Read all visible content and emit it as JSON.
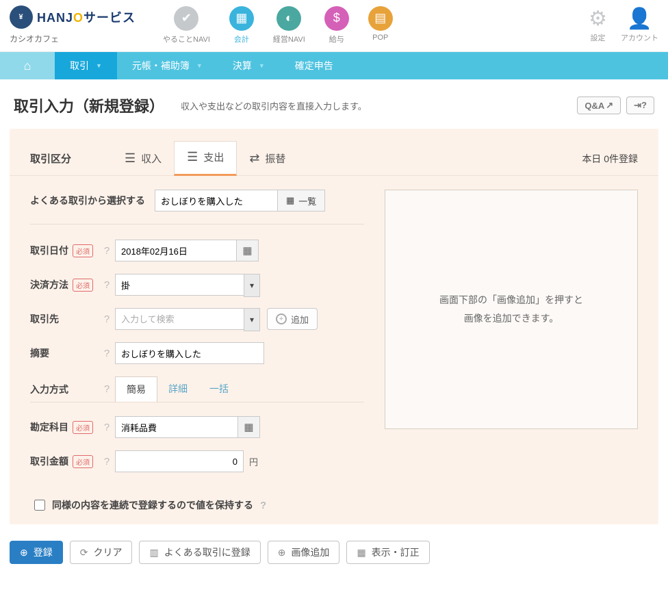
{
  "header": {
    "logo_text_pre": "HANJ",
    "logo_text_o": "O",
    "logo_text_post": "サービス",
    "company": "カシオカフェ",
    "nav": [
      {
        "label": "やることNAVI"
      },
      {
        "label": "会計"
      },
      {
        "label": "経営NAVI"
      },
      {
        "label": "給与"
      },
      {
        "label": "POP"
      }
    ],
    "right": {
      "settings": "設定",
      "account": "アカウント"
    }
  },
  "subnav": {
    "items": [
      {
        "label": "取引"
      },
      {
        "label": "元帳・補助簿"
      },
      {
        "label": "決算"
      },
      {
        "label": "確定申告"
      }
    ]
  },
  "page": {
    "heading": "取引入力（新規登録）",
    "desc": "収入や支出などの取引内容を直接入力します。",
    "qa_label": "Q&A"
  },
  "tabs": {
    "section_label": "取引区分",
    "items": [
      {
        "label": "収入"
      },
      {
        "label": "支出"
      },
      {
        "label": "振替"
      }
    ],
    "today_count": "本日 0件登録"
  },
  "frequent": {
    "label": "よくある取引から選択する",
    "value": "おしぼりを購入した",
    "list_btn": "一覧"
  },
  "form": {
    "required": "必須",
    "date": {
      "label": "取引日付",
      "value": "2018年02月16日"
    },
    "payment": {
      "label": "決済方法",
      "value": "掛"
    },
    "partner": {
      "label": "取引先",
      "placeholder": "入力して検索",
      "add": "追加"
    },
    "memo": {
      "label": "摘要",
      "value": "おしぼりを購入した"
    },
    "mode": {
      "label": "入力方式",
      "tabs": [
        "簡易",
        "詳細",
        "一括"
      ]
    },
    "account": {
      "label": "勘定科目",
      "value": "消耗品費"
    },
    "amount": {
      "label": "取引金額",
      "value": "0",
      "unit": "円"
    }
  },
  "image_hint": {
    "line1": "画面下部の「画像追加」を押すと",
    "line2": "画像を追加できます。"
  },
  "retain": {
    "label": "同様の内容を連続で登録するので値を保持する"
  },
  "buttons": {
    "register": "登録",
    "clear": "クリア",
    "save_frequent": "よくある取引に登録",
    "add_image": "画像追加",
    "view_correct": "表示・訂正"
  }
}
